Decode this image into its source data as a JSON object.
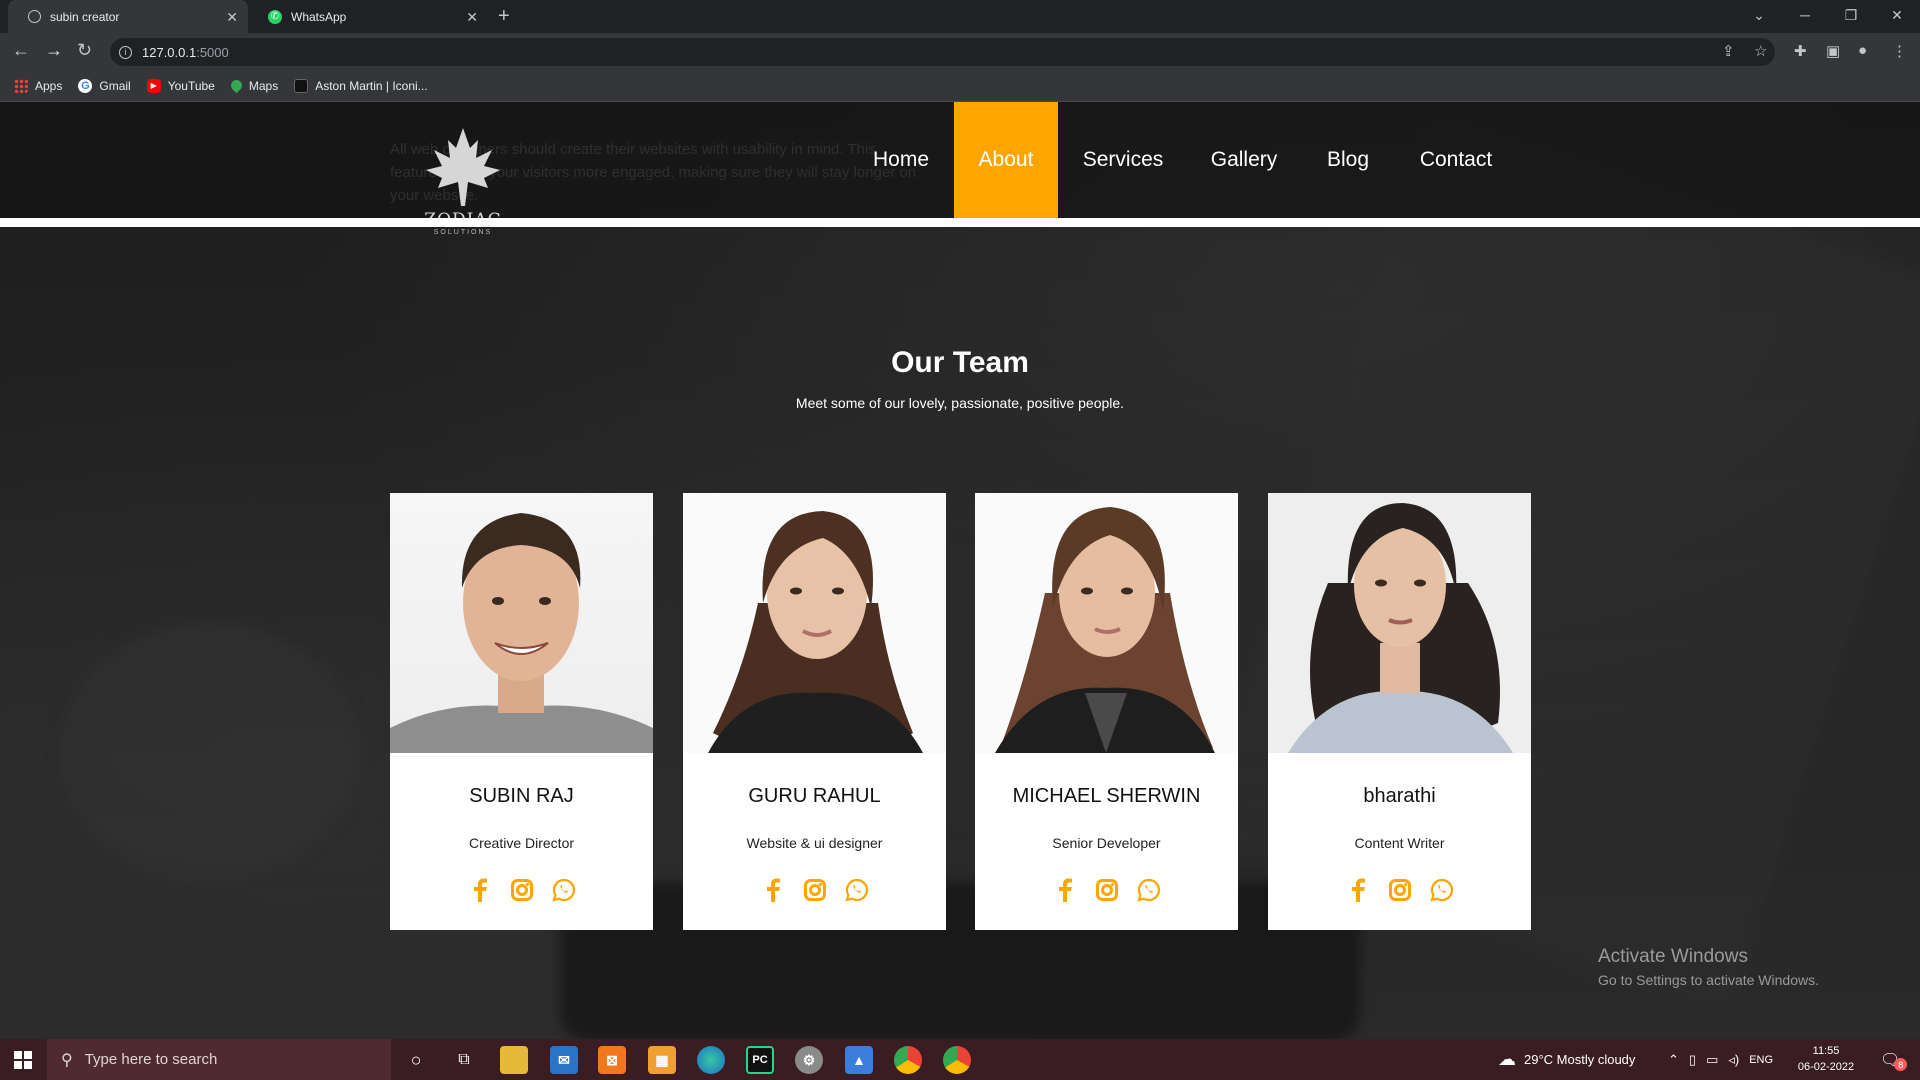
{
  "browser": {
    "tabs": [
      {
        "title": "subin creator",
        "active": true
      },
      {
        "title": "WhatsApp",
        "active": false
      }
    ],
    "address": {
      "host": "127.0.0.1",
      "port": ":5000"
    },
    "bookmarks": [
      "Apps",
      "Gmail",
      "YouTube",
      "Maps",
      "Aston Martin | Iconi..."
    ]
  },
  "site": {
    "ghost_text": "All web designers should create their websites with usability in mind. This feature makes your visitors more engaged, making sure they will stay longer on your website.",
    "logo": {
      "name": "ZODIAC",
      "tagline": "SOLUTIONS"
    },
    "nav": [
      {
        "label": "Home",
        "active": false
      },
      {
        "label": "About",
        "active": true
      },
      {
        "label": "Services",
        "active": false
      },
      {
        "label": "Gallery",
        "active": false
      },
      {
        "label": "Blog",
        "active": false
      },
      {
        "label": "Contact",
        "active": false
      }
    ],
    "accent_color": "#ffa500",
    "team": {
      "title": "Our Team",
      "subtitle": "Meet some of our lovely, passionate, positive people.",
      "members": [
        {
          "name": "SUBIN RAJ",
          "role": "Creative Director"
        },
        {
          "name": "GURU RAHUL",
          "role": "Website & ui designer"
        },
        {
          "name": "MICHAEL SHERWIN",
          "role": "Senior Developer"
        },
        {
          "name": "bharathi",
          "role": "Content Writer"
        }
      ],
      "social_icons": [
        "facebook-icon",
        "instagram-icon",
        "whatsapp-icon"
      ]
    }
  },
  "watermark": {
    "line1": "Activate Windows",
    "line2": "Go to Settings to activate Windows."
  },
  "taskbar": {
    "search_placeholder": "Type here to search",
    "weather": "29°C  Mostly cloudy",
    "language": "ENG",
    "time": "11:55",
    "date": "06-02-2022",
    "notification_count": "8"
  }
}
